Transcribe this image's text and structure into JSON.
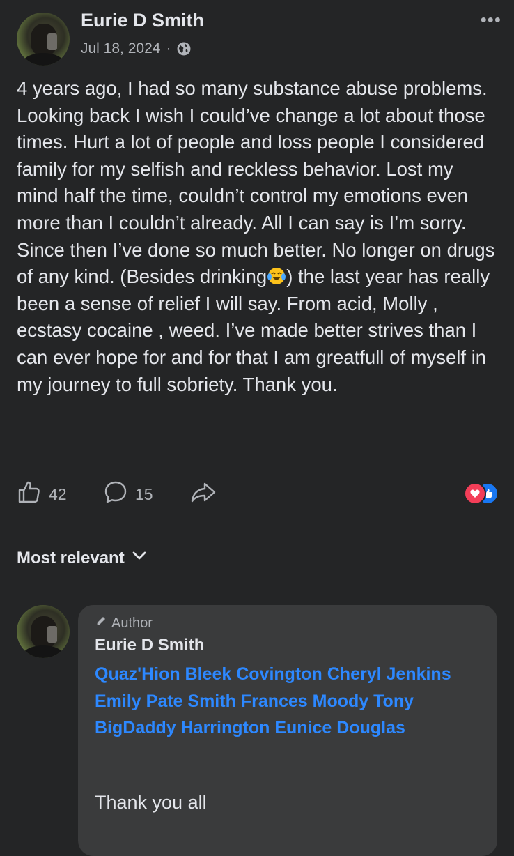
{
  "post": {
    "author": "Eurie D Smith",
    "date": "Jul 18, 2024",
    "separator": "·",
    "audience_icon": "globe-icon",
    "more_icon": "more-dots-icon",
    "more_label": "•••",
    "body_part1": "4 years ago, I had so many substance abuse problems. Looking back I wish I could’ve change a lot about those times. Hurt a lot of people and loss people I considered family for my selfish and reckless behavior. Lost my mind half the time, couldn’t control my emotions even more than I couldn’t already. All I can say is I’m sorry. Since then I’ve done so much better. No longer on drugs of any kind. (Besides drinking",
    "body_emoji": "face-with-tears-of-joy-emoji",
    "body_part2": ") the last year has really been a sense of relief I will say. From acid, Molly , ecstasy cocaine , weed. I’ve made better strives than I can ever hope for and for that I am greatfull of myself in my journey to full sobriety. Thank you."
  },
  "actions": {
    "like_count": "42",
    "comment_count": "15",
    "reactions": [
      "love-reaction-icon",
      "like-reaction-icon"
    ]
  },
  "comments_sort": {
    "label": "Most relevant"
  },
  "comment": {
    "badge": "Author",
    "author": "Eurie D Smith",
    "mentions": [
      "Quaz'Hion Bleek Covington",
      "Cheryl Jenkins",
      "Emily Pate Smith",
      "Frances Moody",
      "Tony BigDaddy Harrington",
      "Eunice Douglas"
    ],
    "text": "Thank you all"
  },
  "colors": {
    "background": "#242526",
    "bubble": "#3a3b3c",
    "text": "#e4e6eb",
    "secondary": "#b0b3b8",
    "link": "#2d88ff",
    "love": "#f33e58",
    "like": "#1877f2"
  }
}
